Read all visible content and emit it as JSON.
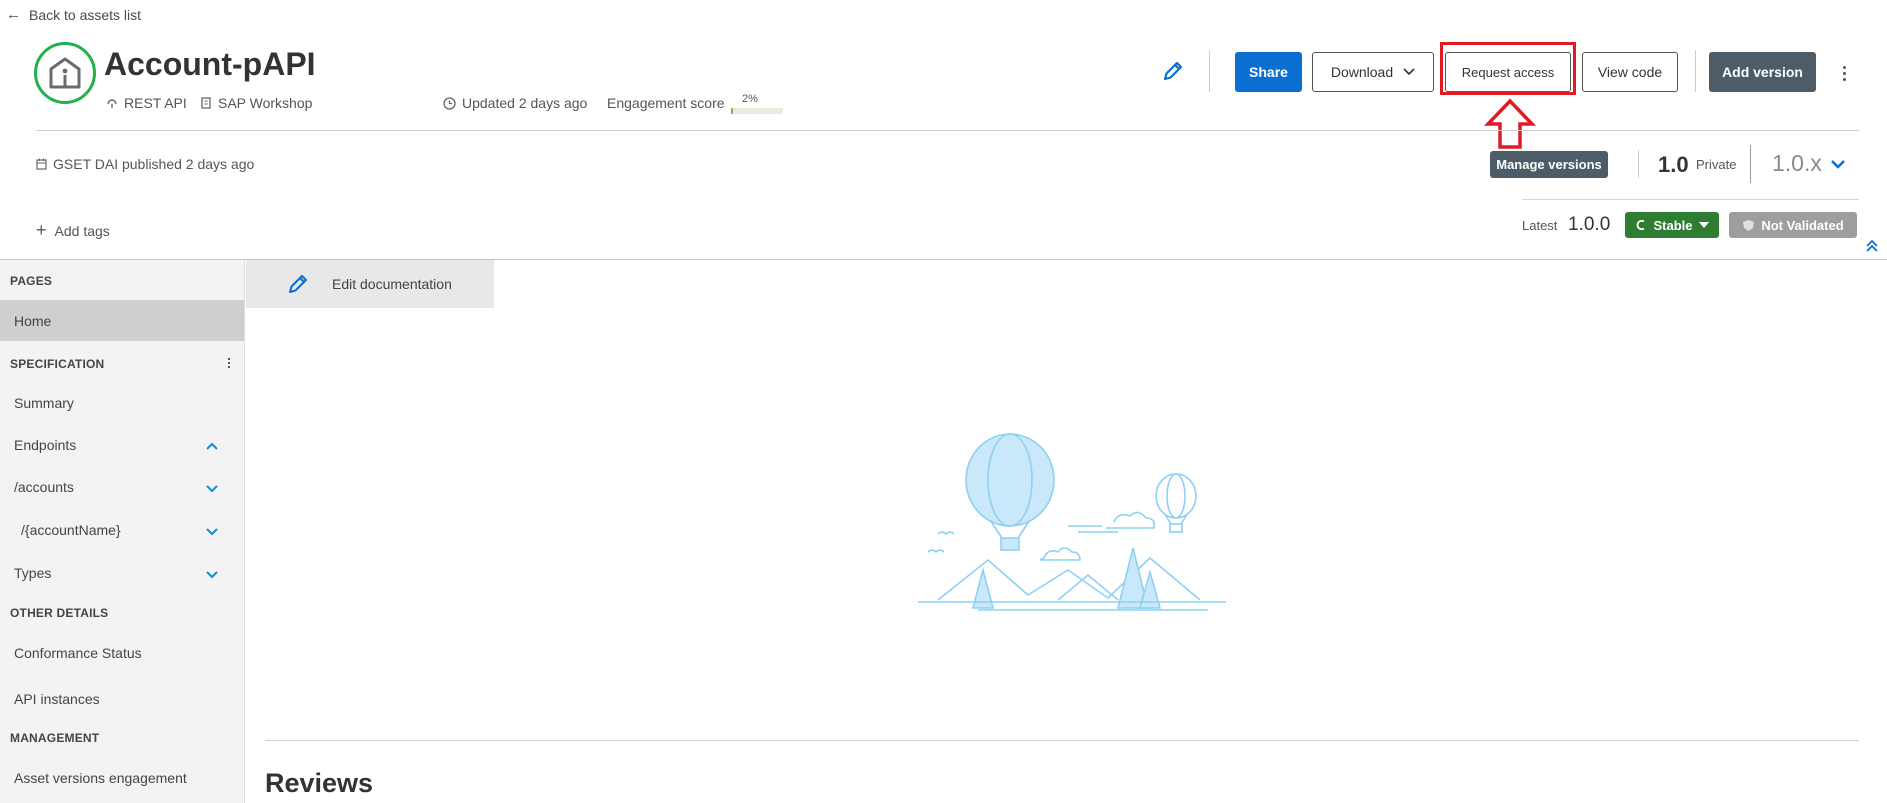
{
  "nav": {
    "back_label": "Back to assets list"
  },
  "asset": {
    "title": "Account-pAPI",
    "type": "REST API",
    "organization": "SAP Workshop",
    "updated": "Updated 2 days ago",
    "engagement_label": "Engagement score",
    "engagement_value": "2%",
    "engagement_fraction": 0.02,
    "published": "GSET DAI published 2 days ago"
  },
  "toolbar": {
    "share": "Share",
    "download": "Download",
    "request_access": "Request access",
    "view_code": "View code",
    "add_version": "Add version"
  },
  "versions": {
    "manage_label": "Manage versions",
    "major": "1.0",
    "privacy": "Private",
    "selected": "1.0.x",
    "latest_label": "Latest",
    "latest_value": "1.0.0",
    "stable_label": "Stable",
    "validation_label": "Not Validated"
  },
  "tags": {
    "add_label": "Add tags"
  },
  "sidebar": {
    "pages_title": "PAGES",
    "home": "Home",
    "spec_title": "SPECIFICATION",
    "summary": "Summary",
    "endpoints": "Endpoints",
    "accounts": "/accounts",
    "account_name": "/{accountName}",
    "types": "Types",
    "other_title": "OTHER DETAILS",
    "conformance": "Conformance Status",
    "api_instances": "API instances",
    "management_title": "MANAGEMENT",
    "asset_versions": "Asset versions engagement"
  },
  "main": {
    "edit_doc": "Edit documentation",
    "reviews": "Reviews"
  },
  "colors": {
    "primary": "#0a6fd1",
    "dark_button": "#4d5c66",
    "stable": "#2e7d32",
    "not_validated": "#9e9e9e",
    "highlight": "#e01b24",
    "logo_ring": "#22b14c"
  }
}
